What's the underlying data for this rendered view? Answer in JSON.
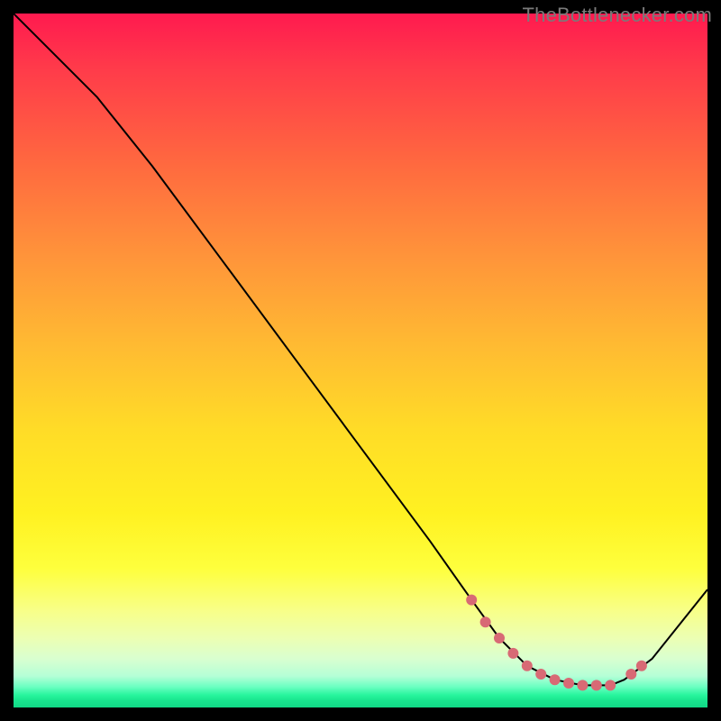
{
  "attribution": "TheBottlenecker.com",
  "chart_data": {
    "type": "line",
    "title": "",
    "xlabel": "",
    "ylabel": "",
    "xlim": [
      0,
      100
    ],
    "ylim": [
      0,
      100
    ],
    "x": [
      0,
      6,
      12,
      20,
      30,
      40,
      50,
      60,
      66,
      70,
      74,
      78,
      82,
      86,
      88,
      92,
      100
    ],
    "values": [
      100,
      94,
      88,
      78,
      64.5,
      51,
      37.5,
      24,
      15.5,
      10,
      6,
      4,
      3.2,
      3.2,
      4,
      7,
      17
    ],
    "markers": {
      "x": [
        66,
        68,
        70,
        72,
        74,
        76,
        78,
        80,
        82,
        84,
        86,
        89,
        90.5
      ],
      "values": [
        15.5,
        12.3,
        10,
        7.8,
        6,
        4.8,
        4,
        3.5,
        3.2,
        3.2,
        3.2,
        4.8,
        6
      ]
    },
    "background_gradient": {
      "top": "#ff1a4f",
      "mid": "#ffe627",
      "bottom": "#11d886"
    }
  }
}
